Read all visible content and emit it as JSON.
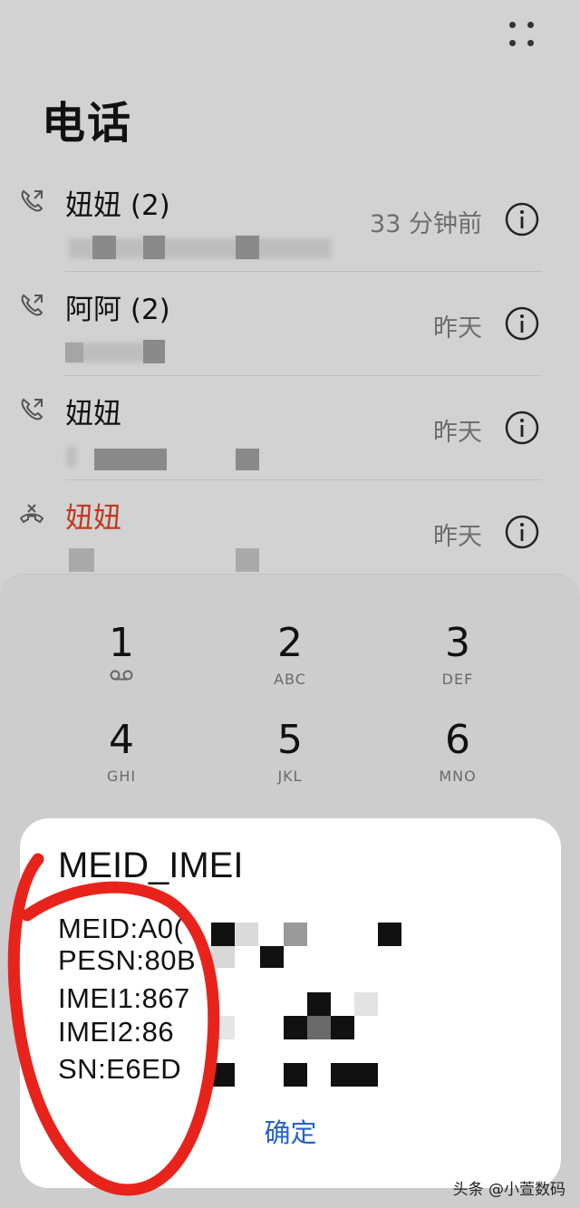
{
  "header": {
    "title": "电话"
  },
  "calls": [
    {
      "name": "妞妞 (2)",
      "time": "33 分钟前",
      "type": "outgoing"
    },
    {
      "name": "阿阿 (2)",
      "time": "昨天",
      "type": "outgoing"
    },
    {
      "name": "妞妞",
      "time": "昨天",
      "type": "outgoing"
    },
    {
      "name": "妞妞",
      "time": "昨天",
      "type": "missed"
    }
  ],
  "dialpad": {
    "keys": [
      {
        "digit": "1",
        "letters": ""
      },
      {
        "digit": "2",
        "letters": "ABC"
      },
      {
        "digit": "3",
        "letters": "DEF"
      },
      {
        "digit": "4",
        "letters": "GHI"
      },
      {
        "digit": "5",
        "letters": "JKL"
      },
      {
        "digit": "6",
        "letters": "MNO"
      }
    ]
  },
  "dialog": {
    "title": "MEID_IMEI",
    "lines": [
      "MEID:A0(",
      "PESN:80B",
      "IMEI1:867",
      "IMEI2:86",
      "SN:E6ED"
    ],
    "confirm_label": "确定"
  },
  "watermark": "头条 @小萱数码",
  "colors": {
    "missed": "#c0391f",
    "accent": "#2563c9",
    "annotation": "#e8231b"
  }
}
